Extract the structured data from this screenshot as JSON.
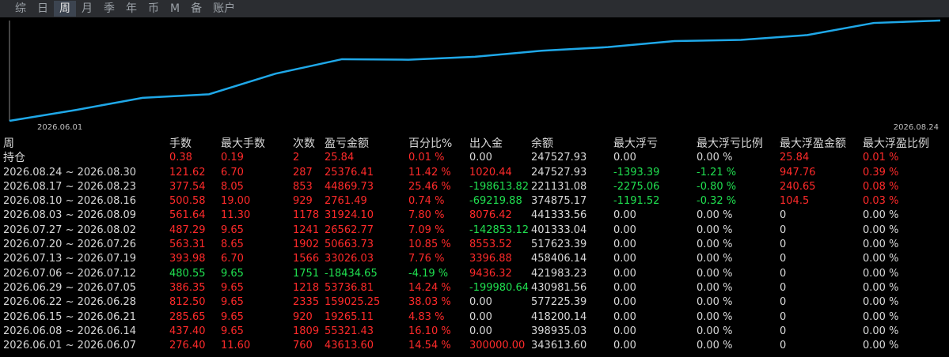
{
  "tabs": [
    {
      "label": "综",
      "active": false
    },
    {
      "label": "日",
      "active": false
    },
    {
      "label": "周",
      "active": true
    },
    {
      "label": "月",
      "active": false
    },
    {
      "label": "季",
      "active": false
    },
    {
      "label": "年",
      "active": false
    },
    {
      "label": "币",
      "active": false
    },
    {
      "label": "M",
      "active": false
    },
    {
      "label": "备",
      "active": false
    },
    {
      "label": "账户",
      "active": false
    }
  ],
  "colors": {
    "line": "#1fa8e8",
    "up": "#ff2a2a",
    "down": "#20e050",
    "neutral": "#d8d8d8",
    "axis": "#888888"
  },
  "chart_data": {
    "type": "line",
    "x_start_label": "2026.06.01",
    "x_end_label": "2026.08.24",
    "series": [
      {
        "values": [
          0,
          45,
          95,
          110,
          195,
          255,
          253,
          265,
          290,
          305,
          330,
          335,
          355,
          405,
          415
        ]
      }
    ]
  },
  "table": {
    "headers": [
      "周",
      "手数",
      "最大手数",
      "次数",
      "盈亏金额",
      "百分比%",
      "出入金",
      "余额",
      "最大浮亏",
      "最大浮亏比例",
      "最大浮盈金额",
      "最大浮盈比例"
    ],
    "rows": [
      {
        "period": "持仓",
        "cells": [
          [
            "0.38",
            "red"
          ],
          [
            "0.19",
            "red"
          ],
          [
            "2",
            "red"
          ],
          [
            "25.84",
            "red"
          ],
          [
            "0.01 %",
            "red"
          ],
          [
            "0.00",
            "white"
          ],
          [
            "247527.93",
            "white"
          ],
          [
            "0.00",
            "white"
          ],
          [
            "0.00 %",
            "white"
          ],
          [
            "25.84",
            "red"
          ],
          [
            "0.01 %",
            "red"
          ]
        ]
      },
      {
        "period": "2026.08.24 ~ 2026.08.30",
        "cells": [
          [
            "121.62",
            "red"
          ],
          [
            "6.70",
            "red"
          ],
          [
            "287",
            "red"
          ],
          [
            "25376.41",
            "red"
          ],
          [
            "11.42 %",
            "red"
          ],
          [
            "1020.44",
            "red"
          ],
          [
            "247527.93",
            "white"
          ],
          [
            "-1393.39",
            "green"
          ],
          [
            "-1.21 %",
            "green"
          ],
          [
            "947.76",
            "red"
          ],
          [
            "0.39 %",
            "red"
          ]
        ]
      },
      {
        "period": "2026.08.17 ~ 2026.08.23",
        "cells": [
          [
            "377.54",
            "red"
          ],
          [
            "8.05",
            "red"
          ],
          [
            "853",
            "red"
          ],
          [
            "44869.73",
            "red"
          ],
          [
            "25.46 %",
            "red"
          ],
          [
            "-198613.82",
            "green"
          ],
          [
            "221131.08",
            "white"
          ],
          [
            "-2275.06",
            "green"
          ],
          [
            "-0.80 %",
            "green"
          ],
          [
            "240.65",
            "red"
          ],
          [
            "0.08 %",
            "red"
          ]
        ]
      },
      {
        "period": "2026.08.10 ~ 2026.08.16",
        "cells": [
          [
            "500.58",
            "red"
          ],
          [
            "19.00",
            "red"
          ],
          [
            "929",
            "red"
          ],
          [
            "2761.49",
            "red"
          ],
          [
            "0.74 %",
            "red"
          ],
          [
            "-69219.88",
            "green"
          ],
          [
            "374875.17",
            "white"
          ],
          [
            "-1191.52",
            "green"
          ],
          [
            "-0.32 %",
            "green"
          ],
          [
            "104.5",
            "red"
          ],
          [
            "0.03 %",
            "red"
          ]
        ]
      },
      {
        "period": "2026.08.03 ~ 2026.08.09",
        "cells": [
          [
            "561.64",
            "red"
          ],
          [
            "11.30",
            "red"
          ],
          [
            "1178",
            "red"
          ],
          [
            "31924.10",
            "red"
          ],
          [
            "7.80 %",
            "red"
          ],
          [
            "8076.42",
            "red"
          ],
          [
            "441333.56",
            "white"
          ],
          [
            "0.00",
            "white"
          ],
          [
            "0.00 %",
            "white"
          ],
          [
            "0",
            "white"
          ],
          [
            "0.00 %",
            "white"
          ]
        ]
      },
      {
        "period": "2026.07.27 ~ 2026.08.02",
        "cells": [
          [
            "487.29",
            "red"
          ],
          [
            "9.65",
            "red"
          ],
          [
            "1241",
            "red"
          ],
          [
            "26562.77",
            "red"
          ],
          [
            "7.09 %",
            "red"
          ],
          [
            "-142853.12",
            "green"
          ],
          [
            "401333.04",
            "white"
          ],
          [
            "0.00",
            "white"
          ],
          [
            "0.00 %",
            "white"
          ],
          [
            "0",
            "white"
          ],
          [
            "0.00 %",
            "white"
          ]
        ]
      },
      {
        "period": "2026.07.20 ~ 2026.07.26",
        "cells": [
          [
            "563.31",
            "red"
          ],
          [
            "8.65",
            "red"
          ],
          [
            "1902",
            "red"
          ],
          [
            "50663.73",
            "red"
          ],
          [
            "10.85 %",
            "red"
          ],
          [
            "8553.52",
            "red"
          ],
          [
            "517623.39",
            "white"
          ],
          [
            "0.00",
            "white"
          ],
          [
            "0.00 %",
            "white"
          ],
          [
            "0",
            "white"
          ],
          [
            "0.00 %",
            "white"
          ]
        ]
      },
      {
        "period": "2026.07.13 ~ 2026.07.19",
        "cells": [
          [
            "393.98",
            "red"
          ],
          [
            "6.70",
            "red"
          ],
          [
            "1566",
            "red"
          ],
          [
            "33026.03",
            "red"
          ],
          [
            "7.76 %",
            "red"
          ],
          [
            "3396.88",
            "red"
          ],
          [
            "458406.14",
            "white"
          ],
          [
            "0.00",
            "white"
          ],
          [
            "0.00 %",
            "white"
          ],
          [
            "0",
            "white"
          ],
          [
            "0.00 %",
            "white"
          ]
        ]
      },
      {
        "period": "2026.07.06 ~ 2026.07.12",
        "cells": [
          [
            "480.55",
            "green"
          ],
          [
            "9.65",
            "green"
          ],
          [
            "1751",
            "green"
          ],
          [
            "-18434.65",
            "green"
          ],
          [
            "-4.19 %",
            "green"
          ],
          [
            "9436.32",
            "red"
          ],
          [
            "421983.23",
            "white"
          ],
          [
            "0.00",
            "white"
          ],
          [
            "0.00 %",
            "white"
          ],
          [
            "0",
            "white"
          ],
          [
            "0.00 %",
            "white"
          ]
        ]
      },
      {
        "period": "2026.06.29 ~ 2026.07.05",
        "cells": [
          [
            "386.35",
            "red"
          ],
          [
            "9.65",
            "red"
          ],
          [
            "1218",
            "red"
          ],
          [
            "53736.81",
            "red"
          ],
          [
            "14.24 %",
            "red"
          ],
          [
            "-199980.64",
            "green"
          ],
          [
            "430981.56",
            "white"
          ],
          [
            "0.00",
            "white"
          ],
          [
            "0.00 %",
            "white"
          ],
          [
            "0",
            "white"
          ],
          [
            "0.00 %",
            "white"
          ]
        ]
      },
      {
        "period": "2026.06.22 ~ 2026.06.28",
        "cells": [
          [
            "812.50",
            "red"
          ],
          [
            "9.65",
            "red"
          ],
          [
            "2335",
            "red"
          ],
          [
            "159025.25",
            "red"
          ],
          [
            "38.03 %",
            "red"
          ],
          [
            "0.00",
            "white"
          ],
          [
            "577225.39",
            "white"
          ],
          [
            "0.00",
            "white"
          ],
          [
            "0.00 %",
            "white"
          ],
          [
            "0",
            "white"
          ],
          [
            "0.00 %",
            "white"
          ]
        ]
      },
      {
        "period": "2026.06.15 ~ 2026.06.21",
        "cells": [
          [
            "285.65",
            "red"
          ],
          [
            "9.65",
            "red"
          ],
          [
            "920",
            "red"
          ],
          [
            "19265.11",
            "red"
          ],
          [
            "4.83 %",
            "red"
          ],
          [
            "0.00",
            "white"
          ],
          [
            "418200.14",
            "white"
          ],
          [
            "0.00",
            "white"
          ],
          [
            "0.00 %",
            "white"
          ],
          [
            "0",
            "white"
          ],
          [
            "0.00 %",
            "white"
          ]
        ]
      },
      {
        "period": "2026.06.08 ~ 2026.06.14",
        "cells": [
          [
            "437.40",
            "red"
          ],
          [
            "9.65",
            "red"
          ],
          [
            "1809",
            "red"
          ],
          [
            "55321.43",
            "red"
          ],
          [
            "16.10 %",
            "red"
          ],
          [
            "0.00",
            "white"
          ],
          [
            "398935.03",
            "white"
          ],
          [
            "0.00",
            "white"
          ],
          [
            "0.00 %",
            "white"
          ],
          [
            "0",
            "white"
          ],
          [
            "0.00 %",
            "white"
          ]
        ]
      },
      {
        "period": "2026.06.01 ~ 2026.06.07",
        "cells": [
          [
            "276.40",
            "red"
          ],
          [
            "11.60",
            "red"
          ],
          [
            "760",
            "red"
          ],
          [
            "43613.60",
            "red"
          ],
          [
            "14.54 %",
            "red"
          ],
          [
            "300000.00",
            "red"
          ],
          [
            "343613.60",
            "white"
          ],
          [
            "0.00",
            "white"
          ],
          [
            "0.00 %",
            "white"
          ],
          [
            "0",
            "white"
          ],
          [
            "0.00 %",
            "white"
          ]
        ]
      }
    ]
  }
}
